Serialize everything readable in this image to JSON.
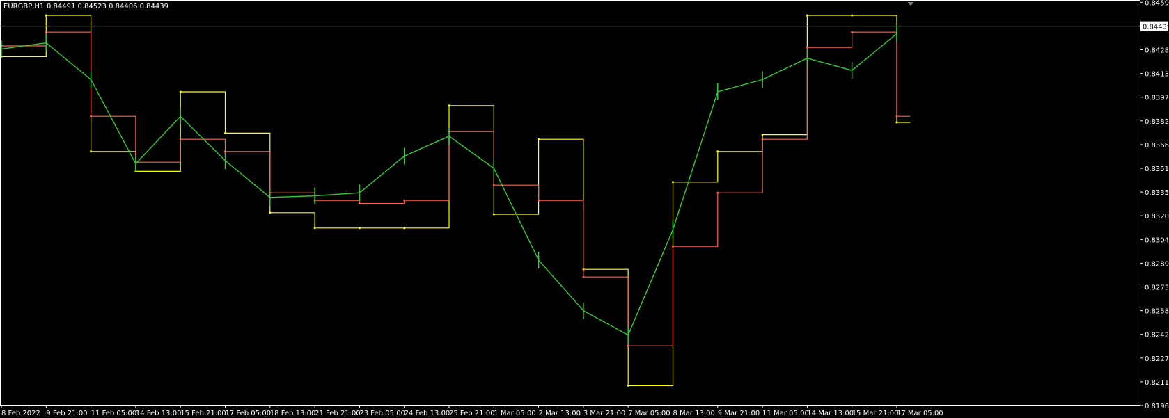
{
  "symbol_header": {
    "symbol": "EURGBP,H1",
    "ohlc": "0.84491 0.84523 0.84406 0.84439"
  },
  "current_price_label": "0.84439",
  "colors": {
    "background": "#000000",
    "candles": "#32CD32",
    "upper_channel": "#FFFF00",
    "mid_channel": "#FF6347",
    "grid_line": "#C0C0C0",
    "text": "#FFFFFF"
  },
  "chart_data": {
    "type": "line",
    "title": "EURGBP,H1",
    "xlabel": "",
    "ylabel": "",
    "ylim": [
      0.8196,
      0.8461
    ],
    "x_tick_labels": [
      "8 Feb 2022",
      "9 Feb 21:00",
      "11 Feb 05:00",
      "14 Feb 13:00",
      "15 Feb 21:00",
      "17 Feb 05:00",
      "18 Feb 13:00",
      "21 Feb 21:00",
      "23 Feb 05:00",
      "24 Feb 13:00",
      "25 Feb 21:00",
      "1 Mar 05:00",
      "2 Mar 13:00",
      "3 Mar 21:00",
      "7 Mar 05:00",
      "8 Mar 13:00",
      "9 Mar 21:00",
      "11 Mar 05:00",
      "14 Mar 13:00",
      "15 Mar 21:00",
      "17 Mar 05:00"
    ],
    "y_tick_labels": [
      "0.84595",
      "0.84285",
      "0.84130",
      "0.83975",
      "0.83820",
      "0.83665",
      "0.83510",
      "0.83355",
      "0.83200",
      "0.83045",
      "0.82890",
      "0.82735",
      "0.82580",
      "0.82425",
      "0.82270",
      "0.82115",
      "0.81960"
    ],
    "grid": false,
    "current_price": 0.84439,
    "series": [
      {
        "color": "#32CD32",
        "kind": "bars",
        "x": [
          "8 Feb 2022",
          "9 Feb 21:00",
          "11 Feb 05:00",
          "14 Feb 13:00",
          "15 Feb 21:00",
          "17 Feb 05:00",
          "18 Feb 13:00",
          "21 Feb 21:00",
          "23 Feb 05:00",
          "24 Feb 13:00",
          "25 Feb 21:00",
          "1 Mar 05:00",
          "2 Mar 13:00",
          "3 Mar 21:00",
          "7 Mar 05:00",
          "8 Mar 13:00",
          "9 Mar 21:00",
          "11 Mar 05:00",
          "14 Mar 13:00",
          "15 Mar 21:00",
          "17 Mar 05:00"
        ],
        "values": [
          0.8429,
          0.8433,
          0.8409,
          0.8354,
          0.8385,
          0.8356,
          0.8332,
          0.8333,
          0.8335,
          0.8359,
          0.8372,
          0.8351,
          0.8291,
          0.8258,
          0.8242,
          0.8311,
          0.8401,
          0.8409,
          0.8423,
          0.8415,
          0.8439
        ]
      },
      {
        "color": "#FFFF00",
        "kind": "step",
        "x": [
          "8 Feb 2022",
          "9 Feb 21:00",
          "11 Feb 05:00",
          "14 Feb 13:00",
          "15 Feb 21:00",
          "17 Feb 05:00",
          "18 Feb 13:00",
          "21 Feb 21:00",
          "23 Feb 05:00",
          "24 Feb 13:00",
          "25 Feb 21:00",
          "1 Mar 05:00",
          "2 Mar 13:00",
          "3 Mar 21:00",
          "7 Mar 05:00",
          "8 Mar 13:00",
          "9 Mar 21:00",
          "11 Mar 05:00",
          "14 Mar 13:00",
          "15 Mar 21:00",
          "17 Mar 05:00"
        ],
        "values": [
          0.8424,
          0.8451,
          0.8362,
          0.8349,
          0.8401,
          0.8374,
          0.8322,
          0.8312,
          0.8312,
          0.8312,
          0.8392,
          0.8321,
          0.837,
          0.8285,
          0.8209,
          0.8342,
          0.8362,
          0.8373,
          0.8451,
          0.8451,
          0.8381
        ]
      },
      {
        "color": "#FF6347",
        "kind": "step",
        "x": [
          "8 Feb 2022",
          "9 Feb 21:00",
          "11 Feb 05:00",
          "14 Feb 13:00",
          "15 Feb 21:00",
          "17 Feb 05:00",
          "18 Feb 13:00",
          "21 Feb 21:00",
          "23 Feb 05:00",
          "24 Feb 13:00",
          "25 Feb 21:00",
          "1 Mar 05:00",
          "2 Mar 13:00",
          "3 Mar 21:00",
          "7 Mar 05:00",
          "8 Mar 13:00",
          "9 Mar 21:00",
          "11 Mar 05:00",
          "14 Mar 13:00",
          "15 Mar 21:00",
          "17 Mar 05:00"
        ],
        "values": [
          0.8431,
          0.844,
          0.8385,
          0.8355,
          0.837,
          0.8362,
          0.8335,
          0.833,
          0.8328,
          0.833,
          0.8375,
          0.834,
          0.833,
          0.828,
          0.8235,
          0.83,
          0.8335,
          0.837,
          0.843,
          0.844,
          0.8385
        ]
      }
    ]
  }
}
